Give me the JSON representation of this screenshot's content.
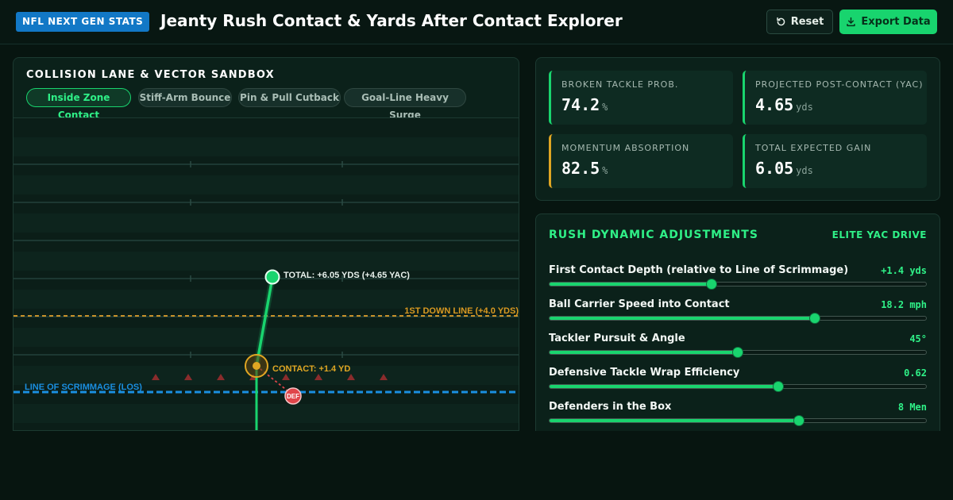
{
  "header": {
    "badge": "NFL NEXT GEN STATS",
    "title": "Jeanty Rush Contact & Yards After Contact Explorer",
    "reset_label": "Reset",
    "export_label": "Export Data"
  },
  "sandbox": {
    "title": "COLLISION LANE & VECTOR SANDBOX",
    "chips": [
      {
        "label": "Inside Zone Contact",
        "active": true
      },
      {
        "label": "Stiff-Arm Bounce",
        "active": false
      },
      {
        "label": "Pin & Pull Cutback",
        "active": false
      },
      {
        "label": "Goal-Line Heavy Surge",
        "active": false
      }
    ],
    "field": {
      "los_label": "LINE OF SCRIMMAGE (LOS)",
      "first_down_label": "1ST DOWN LINE (+4.0 YDS)",
      "contact_label": "CONTACT: +1.4 YD",
      "total_label": "TOTAL: +6.05 YDS (+4.65 YAC)",
      "defender_label": "DEF",
      "first_down_yards": 4.0,
      "contact_yards": 1.4,
      "total_yards": 6.05
    }
  },
  "stats": [
    {
      "label": "BROKEN TACKLE PROB.",
      "value": "74.2",
      "unit": "%",
      "accent": "#19d46e"
    },
    {
      "label": "PROJECTED POST-CONTACT (YAC)",
      "value": "4.65",
      "unit": "yds",
      "accent": "#19d46e"
    },
    {
      "label": "MOMENTUM ABSORPTION",
      "value": "82.5",
      "unit": "%",
      "accent": "#e0a623"
    },
    {
      "label": "TOTAL EXPECTED GAIN",
      "value": "6.05",
      "unit": "yds",
      "accent": "#19d46e"
    }
  ],
  "adjustments": {
    "title": "RUSH DYNAMIC ADJUSTMENTS",
    "tag": "ELITE YAC DRIVE",
    "sliders": [
      {
        "label": "First Contact Depth (relative to Line of Scrimmage)",
        "value": "+1.4 yds",
        "fraction": 0.43
      },
      {
        "label": "Ball Carrier Speed into Contact",
        "value": "18.2 mph",
        "fraction": 0.705
      },
      {
        "label": "Tackler Pursuit & Angle",
        "value": "45°",
        "fraction": 0.5
      },
      {
        "label": "Defensive Tackle Wrap Efficiency",
        "value": "0.62",
        "fraction": 0.607
      },
      {
        "label": "Defenders in the Box",
        "value": "8 Men",
        "fraction": 0.662
      }
    ]
  },
  "colors": {
    "accent_green": "#19d46e",
    "amber": "#e0a623",
    "los_blue": "#1a8fe0",
    "defender_red": "#e0454a",
    "badge_blue": "#1278c6"
  }
}
